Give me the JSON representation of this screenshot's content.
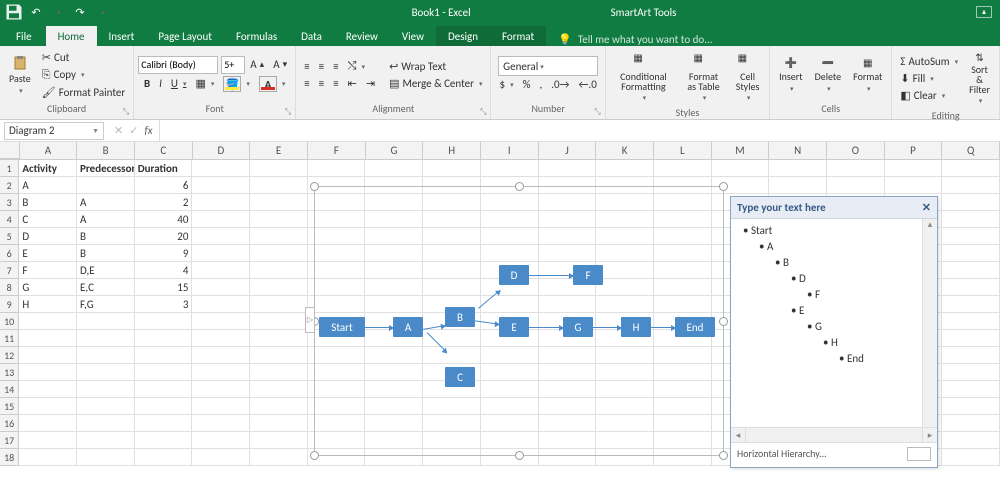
{
  "titlebar": {
    "doc_title": "Book1 - Excel",
    "tools_title": "SmartArt Tools"
  },
  "tabs": {
    "file": "File",
    "items": [
      "Home",
      "Insert",
      "Page Layout",
      "Formulas",
      "Data",
      "Review",
      "View"
    ],
    "context": [
      "Design",
      "Format"
    ],
    "tellme_placeholder": "Tell me what you want to do...",
    "active": "Home"
  },
  "ribbon": {
    "clipboard": {
      "paste": "Paste",
      "cut": "Cut",
      "copy": "Copy",
      "painter": "Format Painter",
      "label": "Clipboard"
    },
    "font": {
      "name": "Calibri (Body)",
      "size": "5+",
      "bold": "B",
      "italic": "I",
      "underline": "U",
      "label": "Font"
    },
    "alignment": {
      "wrap": "Wrap Text",
      "merge": "Merge & Center",
      "label": "Alignment"
    },
    "number": {
      "format": "General",
      "label": "Number"
    },
    "styles": {
      "cond": "Conditional Formatting",
      "table": "Format as Table",
      "cell": "Cell Styles",
      "label": "Styles"
    },
    "cells": {
      "insert": "Insert",
      "delete": "Delete",
      "format": "Format",
      "label": "Cells"
    },
    "editing": {
      "sum": "AutoSum",
      "fill": "Fill",
      "clear": "Clear",
      "sort": "Sort & Filter",
      "label": "Editing"
    }
  },
  "namebox": {
    "value": "Diagram 2"
  },
  "columns": [
    "A",
    "B",
    "C",
    "D",
    "E",
    "F",
    "G",
    "H",
    "I",
    "J",
    "K",
    "L",
    "M",
    "N",
    "O",
    "P",
    "Q"
  ],
  "sheet": {
    "headers": [
      "Activity",
      "Predecessor",
      "Duration"
    ],
    "rows": [
      {
        "a": "A",
        "p": "",
        "d": "6"
      },
      {
        "a": "B",
        "p": "A",
        "d": "2"
      },
      {
        "a": "C",
        "p": "A",
        "d": "40"
      },
      {
        "a": "D",
        "p": "B",
        "d": "20"
      },
      {
        "a": "E",
        "p": "B",
        "d": "9"
      },
      {
        "a": "F",
        "p": "D,E",
        "d": "4"
      },
      {
        "a": "G",
        "p": "E,C",
        "d": "15"
      },
      {
        "a": "H",
        "p": "F,G",
        "d": "3"
      }
    ]
  },
  "smartart": {
    "nodes": [
      "Start",
      "A",
      "B",
      "C",
      "D",
      "E",
      "F",
      "G",
      "H",
      "End"
    ]
  },
  "textpane": {
    "title": "Type your text here",
    "items": [
      {
        "indent": 0,
        "text": "Start"
      },
      {
        "indent": 1,
        "text": "A"
      },
      {
        "indent": 2,
        "text": "B"
      },
      {
        "indent": 3,
        "text": "D"
      },
      {
        "indent": 4,
        "text": "F"
      },
      {
        "indent": 3,
        "text": "E"
      },
      {
        "indent": 4,
        "text": "G"
      },
      {
        "indent": 5,
        "text": "H"
      },
      {
        "indent": 6,
        "text": "End"
      }
    ],
    "footer": "Horizontal Hierarchy..."
  }
}
